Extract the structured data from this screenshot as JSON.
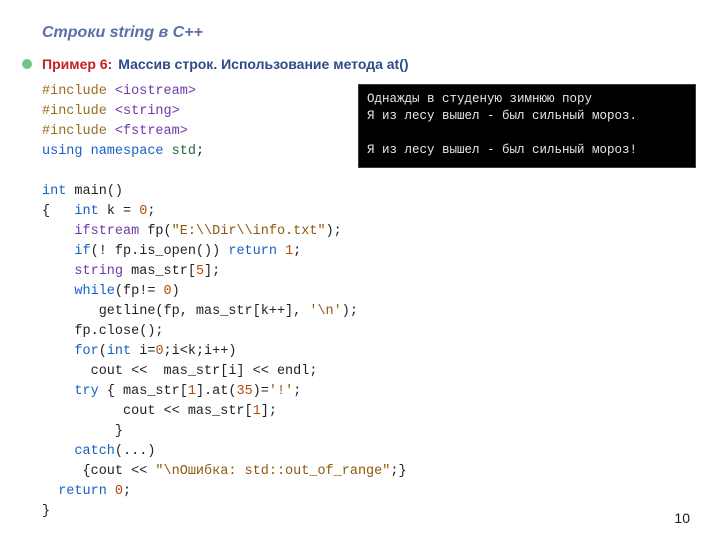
{
  "header": {
    "title": "Строки  string в С++",
    "example_label": "Пример 6:",
    "example_text": "Массив строк. Использование метода at()"
  },
  "code": {
    "lines": [
      [
        {
          "t": "#include ",
          "c": "pp"
        },
        {
          "t": "<iostream>",
          "c": "ty"
        }
      ],
      [
        {
          "t": "#include ",
          "c": "pp"
        },
        {
          "t": "<string>",
          "c": "ty"
        }
      ],
      [
        {
          "t": "#include ",
          "c": "pp"
        },
        {
          "t": "<fstream>",
          "c": "ty"
        }
      ],
      [
        {
          "t": "using namespace ",
          "c": "kw"
        },
        {
          "t": "std",
          "c": "id"
        },
        {
          "t": ";",
          "c": "plain"
        }
      ],
      [
        {
          "t": "",
          "c": "plain"
        }
      ],
      [
        {
          "t": "int ",
          "c": "kw"
        },
        {
          "t": "main",
          "c": "plain"
        },
        {
          "t": "()",
          "c": "plain"
        }
      ],
      [
        {
          "t": "{   ",
          "c": "plain"
        },
        {
          "t": "int ",
          "c": "kw"
        },
        {
          "t": "k = ",
          "c": "plain"
        },
        {
          "t": "0",
          "c": "num"
        },
        {
          "t": ";",
          "c": "plain"
        }
      ],
      [
        {
          "t": "    ",
          "c": "plain"
        },
        {
          "t": "ifstream",
          "c": "ty"
        },
        {
          "t": " fp(",
          "c": "plain"
        },
        {
          "t": "\"E:\\\\Dir\\\\info.txt\"",
          "c": "str"
        },
        {
          "t": ");",
          "c": "plain"
        }
      ],
      [
        {
          "t": "    ",
          "c": "plain"
        },
        {
          "t": "if",
          "c": "kw"
        },
        {
          "t": "(! fp.is_open()) ",
          "c": "plain"
        },
        {
          "t": "return ",
          "c": "kw"
        },
        {
          "t": "1",
          "c": "num"
        },
        {
          "t": ";",
          "c": "plain"
        }
      ],
      [
        {
          "t": "    ",
          "c": "plain"
        },
        {
          "t": "string",
          "c": "ty"
        },
        {
          "t": " mas_str[",
          "c": "plain"
        },
        {
          "t": "5",
          "c": "num"
        },
        {
          "t": "];",
          "c": "plain"
        }
      ],
      [
        {
          "t": "    ",
          "c": "plain"
        },
        {
          "t": "while",
          "c": "kw"
        },
        {
          "t": "(fp!= ",
          "c": "plain"
        },
        {
          "t": "0",
          "c": "num"
        },
        {
          "t": ")",
          "c": "plain"
        }
      ],
      [
        {
          "t": "       getline(fp, mas_str[k++], ",
          "c": "plain"
        },
        {
          "t": "'\\n'",
          "c": "chr"
        },
        {
          "t": ");",
          "c": "plain"
        }
      ],
      [
        {
          "t": "    fp.close();",
          "c": "plain"
        }
      ],
      [
        {
          "t": "    ",
          "c": "plain"
        },
        {
          "t": "for",
          "c": "kw"
        },
        {
          "t": "(",
          "c": "plain"
        },
        {
          "t": "int ",
          "c": "kw"
        },
        {
          "t": "i=",
          "c": "plain"
        },
        {
          "t": "0",
          "c": "num"
        },
        {
          "t": ";i<k;i++)",
          "c": "plain"
        }
      ],
      [
        {
          "t": "      cout <<  mas_str[i] << endl;",
          "c": "plain"
        }
      ],
      [
        {
          "t": "    ",
          "c": "plain"
        },
        {
          "t": "try",
          "c": "kw"
        },
        {
          "t": " { mas_str[",
          "c": "plain"
        },
        {
          "t": "1",
          "c": "num"
        },
        {
          "t": "].at(",
          "c": "plain"
        },
        {
          "t": "35",
          "c": "num"
        },
        {
          "t": ")=",
          "c": "plain"
        },
        {
          "t": "'!'",
          "c": "chr"
        },
        {
          "t": ";",
          "c": "plain"
        }
      ],
      [
        {
          "t": "          cout << mas_str[",
          "c": "plain"
        },
        {
          "t": "1",
          "c": "num"
        },
        {
          "t": "];",
          "c": "plain"
        }
      ],
      [
        {
          "t": "         }",
          "c": "plain"
        }
      ],
      [
        {
          "t": "    ",
          "c": "plain"
        },
        {
          "t": "catch",
          "c": "kw"
        },
        {
          "t": "(...)",
          "c": "plain"
        }
      ],
      [
        {
          "t": "     {cout << ",
          "c": "plain"
        },
        {
          "t": "\"\\nОшибка: std::out_of_range\"",
          "c": "str"
        },
        {
          "t": ";}",
          "c": "plain"
        }
      ],
      [
        {
          "t": "  ",
          "c": "plain"
        },
        {
          "t": "return ",
          "c": "kw"
        },
        {
          "t": "0",
          "c": "num"
        },
        {
          "t": ";",
          "c": "plain"
        }
      ],
      [
        {
          "t": "}",
          "c": "plain"
        }
      ]
    ]
  },
  "output": {
    "lines": [
      "Однажды в студеную зимнюю пору",
      "Я из лесу вышел - был сильный мороз.",
      "",
      "Я из лесу вышел - был сильный мороз!"
    ]
  },
  "page_number": "10"
}
